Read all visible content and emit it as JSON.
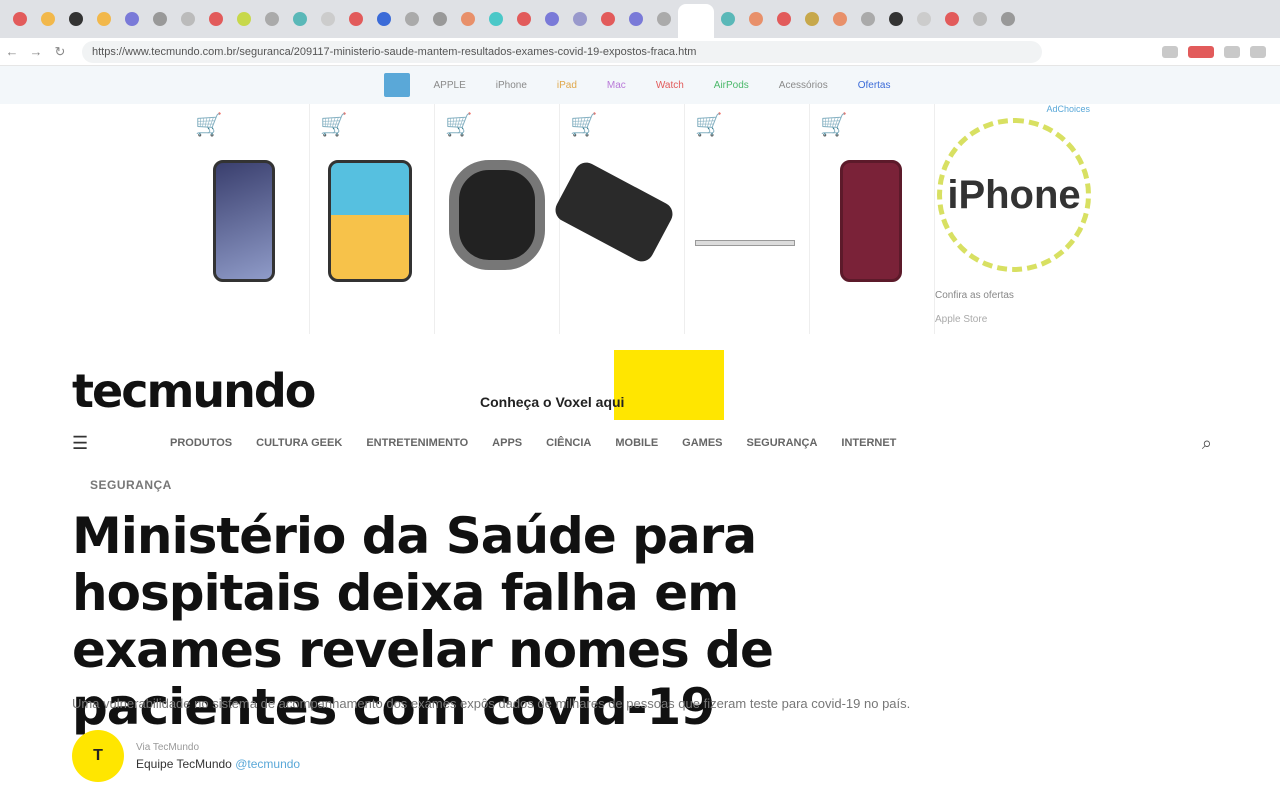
{
  "browser": {
    "tab_favicons": [
      "#e25b5b",
      "#f2b84b",
      "#333333",
      "#f2b84b",
      "#7a7ad8",
      "#999999",
      "#bbbbbb",
      "#e25b5b",
      "#c7d84b",
      "#aaaaaa",
      "#5ab8b8",
      "#cccccc",
      "#e25b5b",
      "#3b6bd8",
      "#aaaaaa",
      "#999999",
      "#e8906a",
      "#4bc8c8",
      "#e25b5b",
      "#7a7ad8",
      "#9999cc",
      "#e25b5b",
      "#7a7ad8",
      "#aaaaaa",
      "#ffffff",
      "#5ab8b8",
      "#e8906a",
      "#e25b5b",
      "#c7a84b",
      "#e8906a",
      "#aaaaaa",
      "#333333",
      "#cccccc",
      "#e25b5b",
      "#bbbbbb",
      "#999999"
    ],
    "url": "https://www.tecmundo.com.br/seguranca/209117-ministerio-saude-mantem-resultados-exames-covid-19-expostos-fraca.htm"
  },
  "ad": {
    "nav_items": [
      "APPLE",
      "iPhone",
      "iPad",
      "Mac",
      "Watch",
      "AirPods",
      "Acessórios",
      "Ofertas"
    ],
    "choices_label": "AdChoices",
    "cart_glyph": "🛒",
    "promo_word": "iPhone",
    "promo_caption": "Confira as ofertas",
    "promo_caption2": "Apple Store"
  },
  "site": {
    "logo": "tecmundo",
    "cta_text": "Conheça o Voxel aqui",
    "nav": [
      "Produtos",
      "Cultura Geek",
      "Entretenimento",
      "Apps",
      "Ciência",
      "Mobile",
      "Games",
      "Segurança",
      "Internet"
    ],
    "menu_glyph": "☰",
    "search_glyph": "⌕"
  },
  "article": {
    "kicker": "Segurança",
    "headline": "Ministério da Saúde para hospitais deixa falha em exames revelar nomes de pacientes com covid-19",
    "deck": "Uma vulnerabilidade no sistema de acompanhamento dos exames expôs dados de milhares de pessoas que fizeram teste para covid-19 no país.",
    "author_initial": "T",
    "author_top": "Via TecMundo",
    "author_name": "Equipe TecMundo",
    "author_handle": "@tecmundo"
  }
}
